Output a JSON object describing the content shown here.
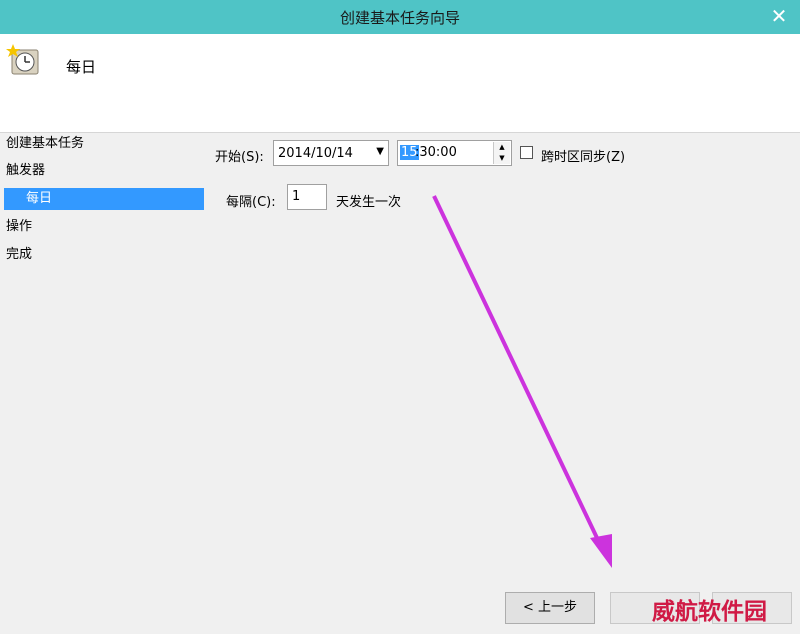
{
  "window": {
    "title": "创建基本任务向导",
    "close_glyph": "✕"
  },
  "header": {
    "icon": "scheduled-task-clock-icon",
    "title": "每日"
  },
  "nav": {
    "items": [
      {
        "label": "创建基本任务"
      },
      {
        "label": "触发器"
      },
      {
        "label": "每日"
      },
      {
        "label": "操作"
      },
      {
        "label": "完成"
      }
    ]
  },
  "form": {
    "start_label": "开始(S):",
    "start_date": "2014/10/14",
    "start_time_hour": "15",
    "start_time_rest": ":30:00",
    "sync_timezone_label": "跨时区同步(Z)",
    "interval_label": "每隔(C):",
    "interval_value": "1",
    "interval_suffix": "天发生一次"
  },
  "buttons": {
    "back": "< 上一步"
  },
  "watermark": "威航软件园",
  "colors": {
    "titlebar": "#4fc4c6",
    "selection": "#3399ff",
    "annotation_arrow": "#cc33dd",
    "watermark": "#d01a45"
  }
}
